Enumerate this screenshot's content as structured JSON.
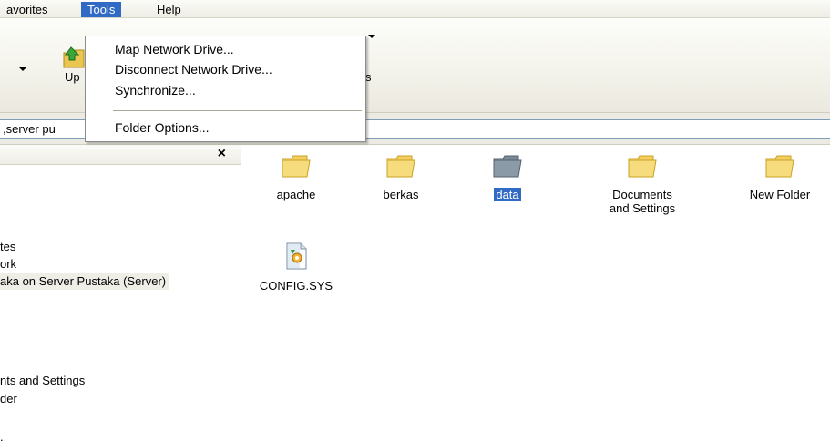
{
  "menubar": {
    "favorites": "avorites",
    "tools": "Tools",
    "help": "Help"
  },
  "toolbar": {
    "up_label": "Up",
    "folders_label_fragment": "s"
  },
  "tools_menu": {
    "items": [
      "Map Network Drive...",
      "Disconnect Network Drive...",
      "Synchronize...",
      "Folder Options..."
    ]
  },
  "address": {
    "value": ",server pu"
  },
  "left_pane": {
    "close": "×",
    "items": [
      "tes",
      "ork",
      "aka on Server Pustaka (Server)",
      "nts and Settings",
      "der",
      "."
    ]
  },
  "files": [
    {
      "name": "apache",
      "type": "folder"
    },
    {
      "name": "berkas",
      "type": "folder"
    },
    {
      "name": "data",
      "type": "folder",
      "selected": true
    },
    {
      "name": "Documents and Settings",
      "type": "folder"
    },
    {
      "name": "New Folder",
      "type": "folder"
    },
    {
      "name": "CONFIG.SYS",
      "type": "system-file"
    }
  ],
  "colors": {
    "selection": "#316ac5",
    "folder": "#f7dc7e",
    "selected_folder": "#8a9aa6"
  }
}
